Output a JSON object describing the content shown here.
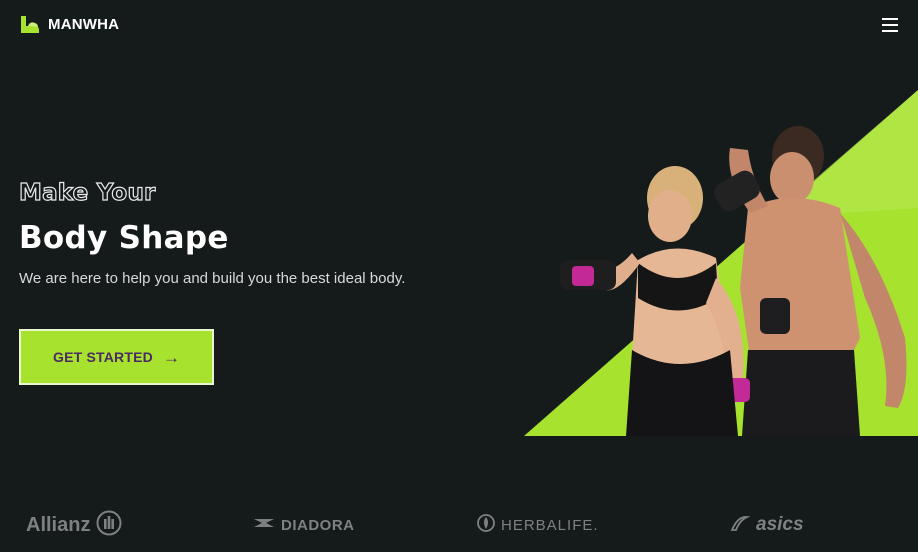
{
  "header": {
    "brand": "MANWHA",
    "logo_icon": "flexed-arm-logo-icon",
    "menu_icon": "hamburger-menu-icon"
  },
  "hero": {
    "outline_heading": "Make Your",
    "heading": "Body Shape",
    "subtitle": "We are here to help you and build you the best ideal body.",
    "cta_label": "GET STARTED",
    "cta_icon": "arrow-right-icon",
    "image": "fitness-couple-with-dumbbells"
  },
  "brands": [
    "Allianz",
    "DIADORA",
    "HERBALIFE.",
    "asics"
  ],
  "colors": {
    "background": "#151a1b",
    "accent": "#a6e22e",
    "cta_text": "#4a2a63",
    "brand_gray": "#7d8183"
  }
}
